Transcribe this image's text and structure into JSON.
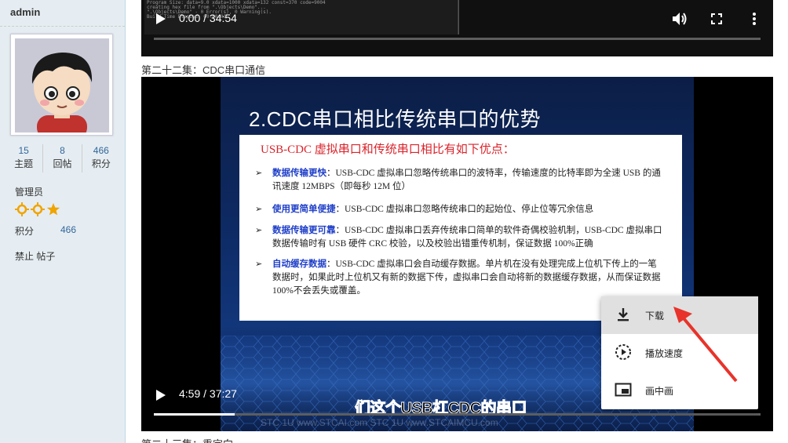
{
  "sidebar": {
    "username": "admin",
    "stats": [
      {
        "value": "15",
        "label": "主题"
      },
      {
        "value": "8",
        "label": "回帖"
      },
      {
        "value": "466",
        "label": "积分"
      }
    ],
    "role": "管理员",
    "points_label": "积分",
    "points_value": "466",
    "actions": "禁止 帖子"
  },
  "top_video": {
    "time": "0:00 / 34:54",
    "code_text": "Program Size: data=9.0 xdata=1000 xdata=132 const=370 code=9004\ncreating hex file from \".\\Objects\\Demo\"...\n\".\\Objects\\Demo\" - 0 Error(s), 0 Warning(s).\nBuild Time Elapsed: 00:00:01"
  },
  "episode_title": "第二十二集：CDC串口通信",
  "main_video": {
    "slide_title": "2.CDC串口相比传统串口的优势",
    "box_heading": "USB-CDC 虚拟串口和传统串口相比有如下优点：",
    "items": [
      {
        "em": "数据传输更快",
        "text": "：USB-CDC 虚拟串口忽略传统串口的波特率，传输速度的比特率即为全速 USB 的通讯速度 12MBPS（即每秒 12M 位）"
      },
      {
        "em": "使用更简单便捷",
        "text": "：USB-CDC 虚拟串口忽略传统串口的起始位、停止位等冗余信息"
      },
      {
        "em": "数据传输更可靠",
        "text": "：USB-CDC 虚拟串口丢弃传统串口简单的软件奇偶校验机制，USB-CDC 虚拟串口数据传输时有 USB 硬件 CRC 校验，以及校验出错重传机制，保证数据 100%正确"
      },
      {
        "em": "自动缓存数据",
        "text": "：USB-CDC 虚拟串口会自动缓存数据。单片机在没有处理完成上位机下传上的一笔数据时，如果此时上位机又有新的数据下传，虚拟串口会自动将新的数据缓存数据，从而保证数据 100%不会丢失或覆盖。"
      }
    ],
    "time": "4:59 / 37:27",
    "progress": 0.133,
    "subtitle": "们这个USB杠CDC的串口",
    "watermark": "STC 1U    www.STCAI.com        STC 1U    www.STCAIMCU.com"
  },
  "context_menu": {
    "items": [
      {
        "label": "下载",
        "icon": "download-icon"
      },
      {
        "label": "播放速度",
        "icon": "playback-speed-icon"
      },
      {
        "label": "画中画",
        "icon": "picture-in-picture-icon"
      }
    ]
  },
  "next_episode_partial": "第二十三集：重定向"
}
